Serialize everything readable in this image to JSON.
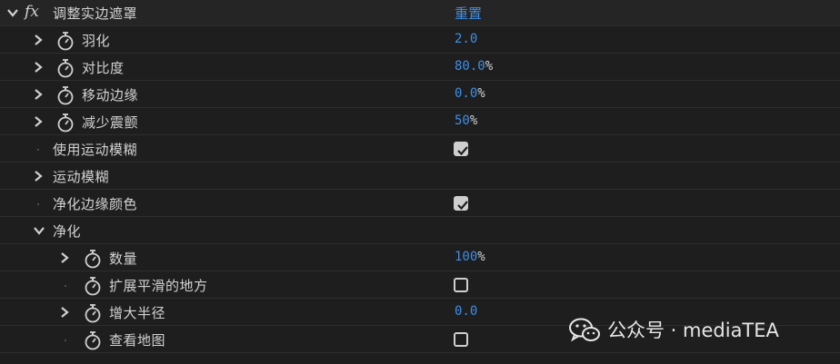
{
  "effect": {
    "name": "调整实边遮罩",
    "fx_label": "fx",
    "reset_label": "重置"
  },
  "params": {
    "feather": {
      "label": "羽化",
      "value": "2.0",
      "unit": ""
    },
    "contrast": {
      "label": "对比度",
      "value": "80.0",
      "unit": "%"
    },
    "shift_edge": {
      "label": "移动边缘",
      "value": "0.0",
      "unit": "%"
    },
    "reduce_chatter": {
      "label": "减少震颤",
      "value": "50",
      "unit": "%"
    },
    "use_motion_blur": {
      "label": "使用运动模糊",
      "checked": true
    },
    "motion_blur": {
      "label": "运动模糊"
    },
    "decontaminate": {
      "label": "净化边缘颜色",
      "checked": true
    },
    "decontam_group": {
      "label": "净化"
    },
    "amount": {
      "label": "数量",
      "value": "100",
      "unit": "%"
    },
    "extend_smooth": {
      "label": "扩展平滑的地方",
      "checked": false
    },
    "increase_radius": {
      "label": "增大半径",
      "value": "0.0",
      "unit": ""
    },
    "view_map": {
      "label": "查看地图",
      "checked": false
    }
  },
  "watermark": {
    "text": "公众号 · mediaTEA",
    "icon": "wechat-icon"
  },
  "colors": {
    "value_blue": "#3d8ee8",
    "background": "#1e1e1e",
    "text": "#d2d2d2"
  }
}
